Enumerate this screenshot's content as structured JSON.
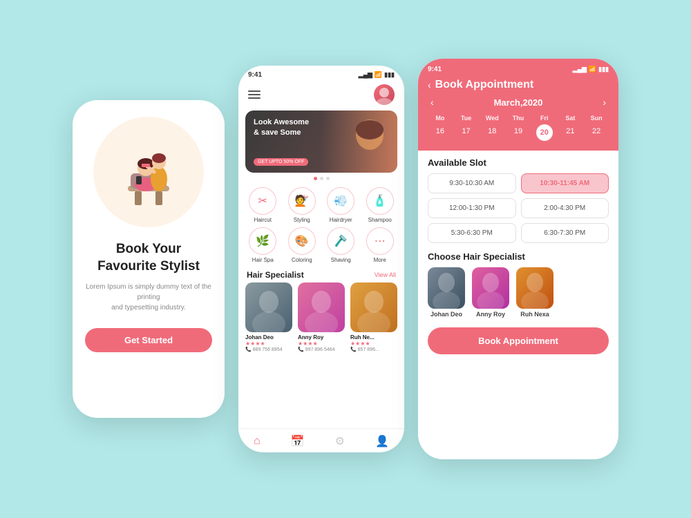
{
  "screen1": {
    "headline": "Book Your\nFavourite Stylist",
    "subtext": "Lorem Ipsum is simply dummy text of the printing\nand typesetting industry.",
    "cta": "Get Started"
  },
  "screen2": {
    "time": "9:41",
    "banner": {
      "text": "Look Awesome\n& save Some",
      "badge": "GET UPTO 50% OFF"
    },
    "services": [
      {
        "label": "Haircut",
        "icon": "✂"
      },
      {
        "label": "Styling",
        "icon": "💇"
      },
      {
        "label": "Hairdryer",
        "icon": "💨"
      },
      {
        "label": "Shampoo",
        "icon": "🧴"
      },
      {
        "label": "Hair Spa",
        "icon": "🌿"
      },
      {
        "label": "Coloring",
        "icon": "🎨"
      },
      {
        "label": "Shaving",
        "icon": "🪒"
      },
      {
        "label": "More",
        "icon": "⋯"
      }
    ],
    "section_title": "Hair Specialist",
    "view_all": "View All",
    "specialists": [
      {
        "name": "Johan Deo",
        "rating": "★★★★",
        "phone": "889 756 8954",
        "photoClass": "p1"
      },
      {
        "name": "Anny Roy",
        "rating": "★★★★",
        "phone": "997 896 5464",
        "photoClass": "p2"
      },
      {
        "name": "Ruh Ne...",
        "rating": "★★★★",
        "phone": "857 896...",
        "photoClass": "p3"
      }
    ]
  },
  "screen3": {
    "time": "9:41",
    "title": "Book Appointment",
    "month": "March,2020",
    "days_header": [
      "Mo",
      "Tue",
      "Wed",
      "Thu",
      "Fri",
      "Sat",
      "Sun"
    ],
    "days": [
      "16",
      "17",
      "18",
      "19",
      "20",
      "21",
      "22"
    ],
    "today": "20",
    "slots_title": "Available Slot",
    "slots": [
      {
        "label": "9:30-10:30 AM",
        "selected": false
      },
      {
        "label": "10:30-11:45 AM",
        "selected": true
      },
      {
        "label": "12:00-1:30 PM",
        "selected": false
      },
      {
        "label": "2:00-4:30 PM",
        "selected": false
      },
      {
        "label": "5:30-6:30 PM",
        "selected": false
      },
      {
        "label": "6:30-7:30 PM",
        "selected": false
      }
    ],
    "specialist_title": "Choose Hair Specialist",
    "specialists": [
      {
        "name": "Johan Deo",
        "photoClass": "sp1"
      },
      {
        "name": "Anny Roy",
        "photoClass": "sp2"
      },
      {
        "name": "Ruh Nexa",
        "photoClass": "sp3"
      }
    ],
    "book_btn": "Book Appointment"
  }
}
